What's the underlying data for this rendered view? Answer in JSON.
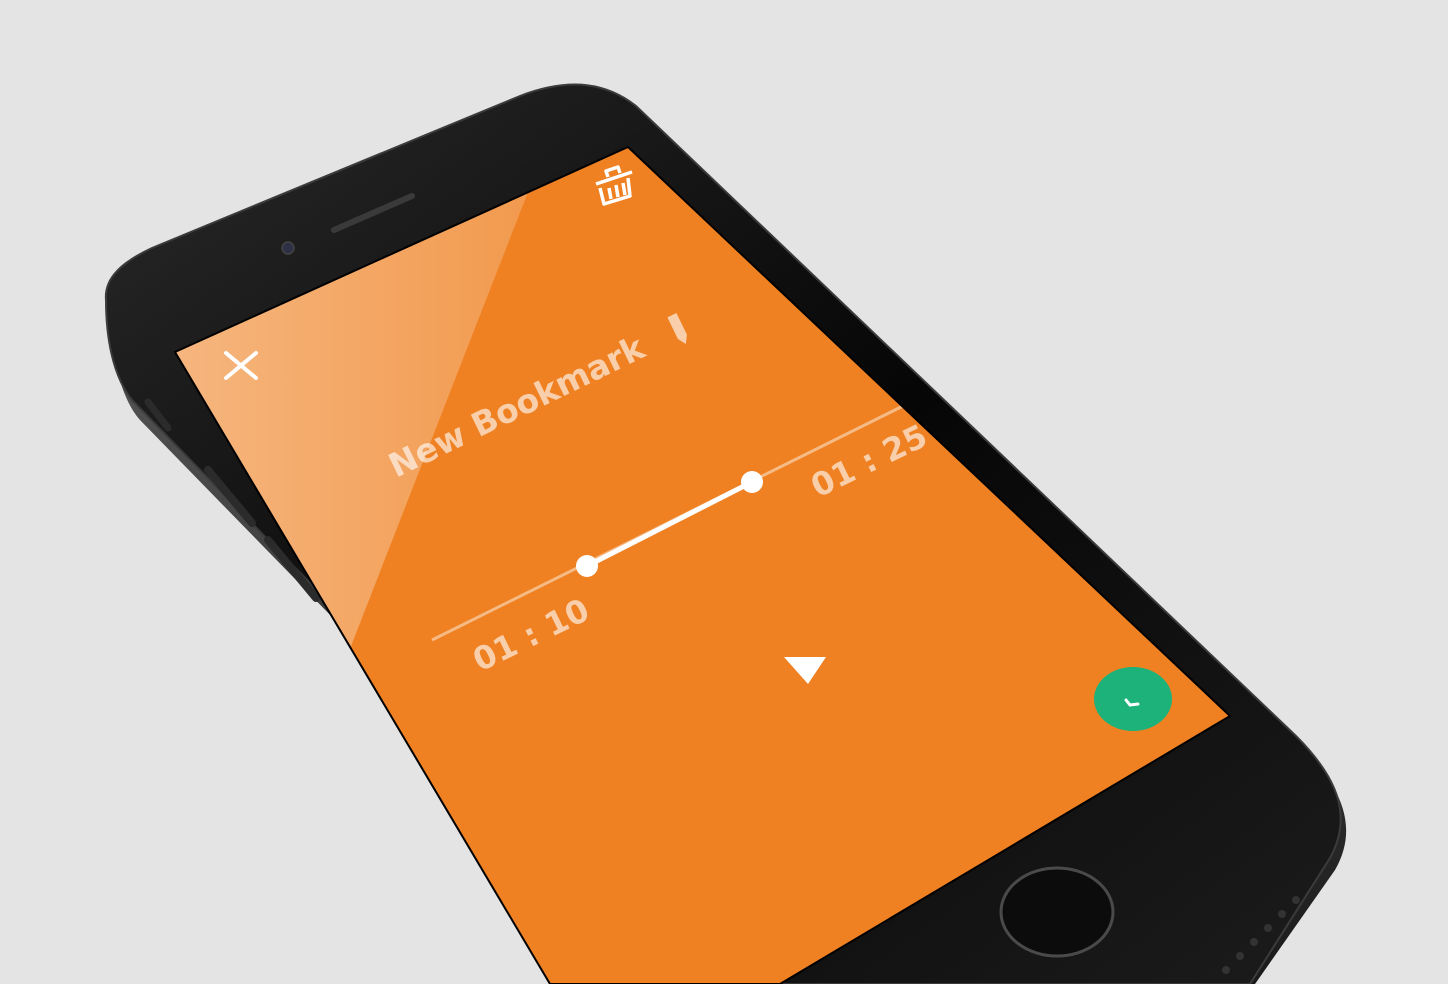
{
  "bookmark": {
    "title": "New Bookmark",
    "start_time": "01 : 10",
    "end_time": "01 : 25"
  },
  "icons": {
    "close": "close-icon",
    "delete": "trash-icon",
    "edit": "pencil-icon",
    "play": "play-icon",
    "confirm": "check-icon"
  },
  "colors": {
    "background": "#e4e4e4",
    "screen": "#ef8122",
    "confirm_button": "#1db27a",
    "phone_body": "#0b0b0b"
  }
}
